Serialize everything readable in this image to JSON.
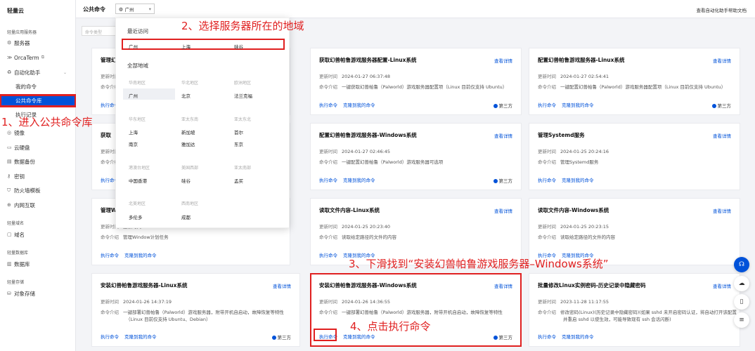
{
  "sidebar": {
    "logo": "轻量云",
    "sec1": "轻量应用服务器",
    "servers": "服务器",
    "orcaterm": "OrcaTerm",
    "automation": "自动化助手",
    "my_commands": "我的命令",
    "public_commands": "公共命令库",
    "exec_records": "执行记录",
    "images": "镜像",
    "cloud_disk": "云硬盘",
    "data_backup": "数据备份",
    "keys": "密钥",
    "firewall_templates": "防火墙模板",
    "intranet": "内网互联",
    "sec2": "轻量域名",
    "domain": "域名",
    "sec3": "轻量数据库",
    "database": "数据库",
    "sec4": "轻量存储",
    "object_storage": "对象存储"
  },
  "topbar": {
    "title": "公共命令",
    "region": "广州",
    "help": "查看自动化助手帮助文档"
  },
  "filter": {
    "placeholder": "命令类型"
  },
  "dropdown": {
    "recent_title": "最近访问",
    "recent": [
      "广州",
      "上海",
      "硅谷"
    ],
    "all_title": "全部地域",
    "g1": [
      "华南地区",
      "华北地区",
      "欧洲地区"
    ],
    "r1a": [
      "广州",
      "北京",
      "法兰克福"
    ],
    "g2": [
      "华东地区",
      "亚太东南",
      "亚太东北"
    ],
    "r2a": [
      "上海",
      "新加坡",
      "首尔"
    ],
    "r2b": [
      "南京",
      "雅加达",
      "东京"
    ],
    "g3": [
      "港澳台地区",
      "美国西部",
      "亚太南部"
    ],
    "r3a": [
      "中国香港",
      "硅谷",
      "孟买"
    ],
    "g4": [
      "北美地区",
      "西南地区"
    ],
    "r4a": [
      "多伦多",
      "成都"
    ]
  },
  "labels": {
    "detail": "查看详情",
    "time_label": "更新时间",
    "intro_label": "命令介绍",
    "exec": "执行命令",
    "clone": "克隆到我的命令",
    "third": "第三方"
  },
  "cards": [
    {
      "title": "管理幻",
      "time": "更新时间",
      "intro": "命令介绍"
    },
    {
      "title": "获取幻兽帕鲁游戏服务器配置-Linux系统",
      "time": "2024-01-27 06:37:48",
      "intro": "一键获取幻兽帕鲁（Palworld）游戏服务器配置项（Linux 目前仅支持 Ubuntu）"
    },
    {
      "title": "配置幻兽帕鲁游戏服务器-Linux系统",
      "time": "2024-01-27 02:54:41",
      "intro": "一键配置幻兽帕鲁（Palworld）游戏服务器配置项（Linux 目前仅支持 Ubuntu）"
    },
    {
      "title": "获取",
      "time": "更新时间",
      "intro": "命令介绍"
    },
    {
      "title": "配置幻兽帕鲁游戏服务器-Windows系统",
      "time": "2024-01-27 02:46:45",
      "intro": "一键配置幻兽帕鲁（Palworld）游戏服务器可选项"
    },
    {
      "title": "管理Systemd服务",
      "time": "2024-01-25 20:24:16",
      "intro": "管理Systemd服务"
    },
    {
      "title": "管理Wi",
      "time": "更新时间",
      "intro": "管理Window计划任务"
    },
    {
      "title": "读取文件内容-Linux系统",
      "time": "2024-01-25 20:23:40",
      "intro": "读取给定路径的文件的内容"
    },
    {
      "title": "读取文件内容-Windows系统",
      "time": "2024-01-25 20:23:15",
      "intro": "读取给定路径的文件的内容"
    },
    {
      "title": "安装幻兽帕鲁游戏服务器-Linux系统",
      "time": "2024-01-26 14:37:19",
      "intro": "一键部署幻兽帕鲁（Palworld）游戏服务器，附带开机自启动，故障恢复等特性",
      "intro2": "（Linux 目前仅支持 Ubuntu、Debian）"
    },
    {
      "title": "安装幻兽帕鲁游戏服务器-Windows系统",
      "time": "2024-01-26 14:36:55",
      "intro": "一键部署幻兽帕鲁（Palworld）游戏服务器，附带开机自启动，故障恢复等特性"
    },
    {
      "title": "批量修改Linux实例密码-历史记录中隐藏密码",
      "time": "2023-11-28 11:17:55",
      "intro": "修改密码(Linux)(历史记录中隐藏密码)(如果 sshd 未开启密码认证，将自动打开该配置",
      "intro2": "并重启 sshd 以使生效，可能导致现有 ssh 会话闪断)"
    }
  ],
  "annotations": {
    "step1": "1、进入公共命令库",
    "step2": "2、选择服务器所在的地域",
    "step3": "3、下滑找到“安装幻兽帕鲁游戏服务器–Windows系统”",
    "step4": "4、点击执行命令"
  },
  "colors": {
    "accent": "#0052d9",
    "annotation": "#e02020"
  }
}
